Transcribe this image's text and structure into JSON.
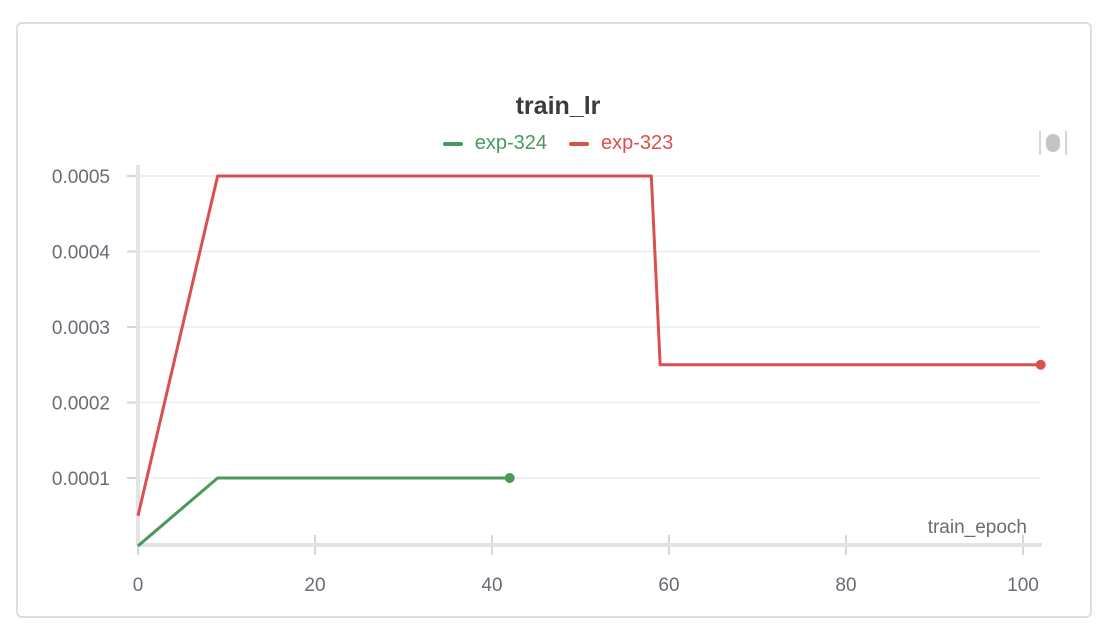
{
  "chart_data": {
    "type": "line",
    "title": "train_lr",
    "xlabel": "train_epoch",
    "ylabel": "",
    "xlim": [
      0,
      102
    ],
    "ylim": [
      1e-05,
      0.0005
    ],
    "x_ticks": [
      0,
      20,
      40,
      60,
      80,
      100
    ],
    "x_tick_labels": [
      "0",
      "20",
      "40",
      "60",
      "80",
      "100"
    ],
    "y_ticks": [
      0.0001,
      0.0002,
      0.0003,
      0.0004,
      0.0005
    ],
    "y_tick_labels": [
      "0.0001",
      "0.0002",
      "0.0003",
      "0.0004",
      "0.0005"
    ],
    "grid": true,
    "legend_position": "top-center",
    "series": [
      {
        "name": "exp-324",
        "color": "#489a5a",
        "points": [
          [
            0,
            1e-05
          ],
          [
            9,
            0.0001
          ],
          [
            42,
            0.0001
          ]
        ]
      },
      {
        "name": "exp-323",
        "color": "#d9514e",
        "points": [
          [
            0,
            5e-05
          ],
          [
            9,
            0.0005
          ],
          [
            58,
            0.0005
          ],
          [
            59,
            0.00025
          ],
          [
            102,
            0.00025
          ]
        ]
      }
    ]
  },
  "panel": {
    "menu_icon": "drag-handle-icon"
  }
}
